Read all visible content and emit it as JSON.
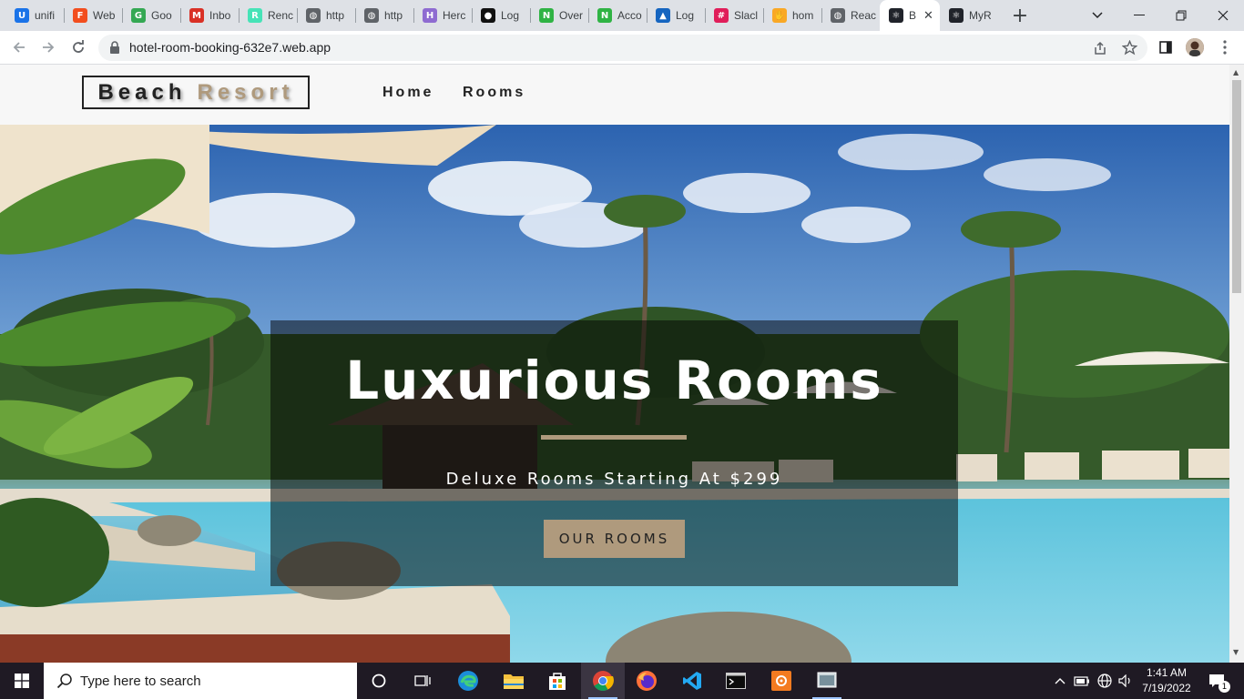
{
  "browser": {
    "tabs": [
      {
        "label": "unifi",
        "color": "#1a73e8",
        "glyph": "U"
      },
      {
        "label": "Web",
        "color": "#f24e1e",
        "glyph": "F"
      },
      {
        "label": "Goo",
        "color": "#34a853",
        "glyph": "G"
      },
      {
        "label": "Inbo",
        "color": "#d93025",
        "glyph": "M"
      },
      {
        "label": "Renc",
        "color": "#46e3b7",
        "glyph": "R"
      },
      {
        "label": "http",
        "color": "#5f6368",
        "glyph": "◍"
      },
      {
        "label": "http",
        "color": "#5f6368",
        "glyph": "◍"
      },
      {
        "label": "Herc",
        "color": "#8e6bd1",
        "glyph": "H"
      },
      {
        "label": "Log",
        "color": "#111111",
        "glyph": "●"
      },
      {
        "label": "Over",
        "color": "#2fb344",
        "glyph": "N"
      },
      {
        "label": "Acco",
        "color": "#2fb344",
        "glyph": "N"
      },
      {
        "label": "Log",
        "color": "#1565c0",
        "glyph": "▲"
      },
      {
        "label": "Slacl",
        "color": "#e01e5a",
        "glyph": "#"
      },
      {
        "label": "hom",
        "color": "#f9a825",
        "glyph": "✋"
      },
      {
        "label": "Reac",
        "color": "#5f6368",
        "glyph": "◍"
      },
      {
        "label": "B",
        "color": "#20232a",
        "glyph": "⚛",
        "active": true
      },
      {
        "label": "MyR",
        "color": "#20232a",
        "glyph": "⚛"
      }
    ],
    "url": "hotel-room-booking-632e7.web.app"
  },
  "site": {
    "logo_part1": "Beach",
    "logo_part2": "Resort",
    "nav": {
      "home": "Home",
      "rooms": "Rooms"
    },
    "hero": {
      "title": "Luxurious Rooms",
      "subtitle": "Deluxe Rooms Starting At $299",
      "button": "OUR ROOMS"
    }
  },
  "taskbar": {
    "search_placeholder": "Type here to search",
    "time": "1:41 AM",
    "date": "7/19/2022",
    "notification_count": "1"
  },
  "colors": {
    "accent": "#af9a7d",
    "nav_bg": "#f7f7f7",
    "text_dark": "#222222"
  }
}
